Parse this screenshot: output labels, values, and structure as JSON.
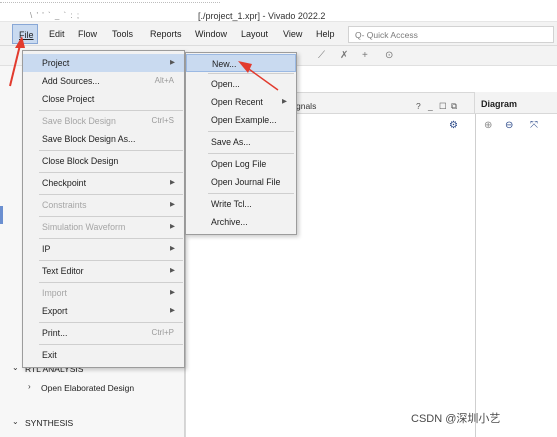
{
  "window": {
    "title": "[./project_1.xpr] - Vivado 2022.2",
    "title_fragment": "\\ ' ' ` _ ` : ;"
  },
  "menubar": {
    "items": [
      "File",
      "Edit",
      "Flow",
      "Tools",
      "Reports",
      "Window",
      "Layout",
      "View",
      "Help"
    ],
    "quick_access_placeholder": "Q- Quick Access"
  },
  "file_menu": {
    "items": [
      {
        "label": "Project",
        "arrow": "▶"
      },
      {
        "label": "Add Sources...",
        "shortcut": "Alt+A"
      },
      {
        "label": "Close Project"
      },
      {
        "label": "Save Block Design",
        "shortcut": "Ctrl+S",
        "disabled": true
      },
      {
        "label": "Save Block Design As..."
      },
      {
        "label": "Close Block Design"
      },
      {
        "label": "Checkpoint",
        "arrow": "▶"
      },
      {
        "label": "Constraints",
        "arrow": "▶",
        "disabled": true
      },
      {
        "label": "Simulation Waveform",
        "arrow": "▶",
        "disabled": true
      },
      {
        "label": "IP",
        "arrow": "▶"
      },
      {
        "label": "Text Editor",
        "arrow": "▶"
      },
      {
        "label": "Import",
        "arrow": "▶",
        "disabled": true
      },
      {
        "label": "Export",
        "arrow": "▶"
      },
      {
        "label": "Print...",
        "shortcut": "Ctrl+P"
      },
      {
        "label": "Exit"
      }
    ]
  },
  "project_submenu": {
    "items": [
      {
        "label": "New..."
      },
      {
        "label": "Open..."
      },
      {
        "label": "Open Recent",
        "arrow": "▶"
      },
      {
        "label": "Open Example..."
      },
      {
        "label": "Save As..."
      },
      {
        "label": "Open Log File"
      },
      {
        "label": "Open Journal File"
      },
      {
        "label": "Write Tcl..."
      },
      {
        "label": "Archive..."
      }
    ]
  },
  "center_panel": {
    "tab_label": "gnals",
    "controls": [
      "?",
      "_",
      "☐",
      "⧉"
    ]
  },
  "diagram_panel": {
    "title": "Diagram"
  },
  "flow_navigator": {
    "rtl_analysis": "RTL ANALYSIS",
    "open_elaborated": "Open Elaborated Design",
    "synthesis": "SYNTHESIS"
  },
  "watermark": "CSDN @深圳小艺",
  "colors": {
    "highlight": "#c9daf0",
    "arrow": "#e23b2e"
  }
}
